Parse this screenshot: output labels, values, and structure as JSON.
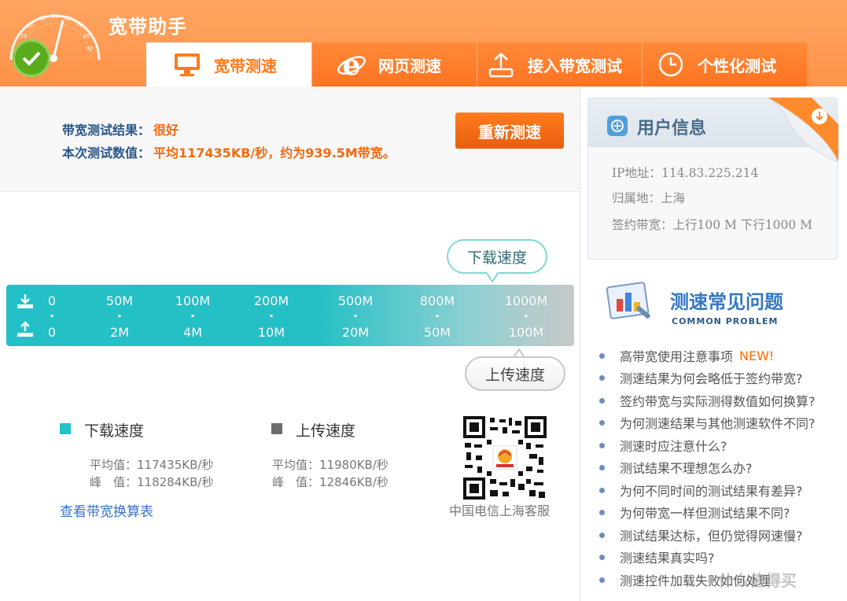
{
  "app": {
    "title": "宽带助手"
  },
  "gauge_ticks": [
    "10",
    "20",
    "30",
    "40",
    "50",
    "60",
    "70",
    "80",
    "90"
  ],
  "tabs": [
    {
      "label": "宽带测速",
      "icon": "monitor-icon",
      "active": true
    },
    {
      "label": "网页测速",
      "icon": "ie-browser-icon",
      "active": false
    },
    {
      "label": "接入带宽测试",
      "icon": "upload-tray-icon",
      "active": false
    },
    {
      "label": "个性化测试",
      "icon": "clock-icon",
      "active": false
    }
  ],
  "result": {
    "label1": "带宽测试结果：",
    "value1": "很好",
    "label2": "本次测试数值：",
    "value2": "平均117435KB/秒，约为939.5M带宽。",
    "retest_label": "重新测速"
  },
  "speed_bar": {
    "download_bubble": "下载速度",
    "upload_bubble": "上传速度",
    "download_ticks": [
      "0",
      "50M",
      "100M",
      "200M",
      "500M",
      "800M",
      "1000M"
    ],
    "upload_ticks": [
      "0",
      "2M",
      "4M",
      "10M",
      "20M",
      "50M",
      "100M"
    ]
  },
  "stats": {
    "download": {
      "title": "下载速度",
      "avg": "平均值：117435KB/秒",
      "peak": "峰　值：118284KB/秒",
      "color": "#1fc3c9"
    },
    "upload": {
      "title": "上传速度",
      "avg": "平均值：11980KB/秒",
      "peak": "峰　值：12846KB/秒",
      "color": "#6d6d6d"
    },
    "link": "查看带宽换算表",
    "qr_label": "中国电信上海客服"
  },
  "user_info": {
    "title": "用户信息",
    "ip": "IP地址：114.83.225.214",
    "location": "归属地：上海",
    "bandwidth": "签约带宽：上行100 M 下行1000 M"
  },
  "faq": {
    "title": "测速常见问题",
    "subtitle": "COMMON PROBLEM",
    "new_badge": "NEW!",
    "items": [
      "高带宽使用注意事项",
      "测速结果为何会略低于签约带宽?",
      "签约带宽与实际测得数值如何换算?",
      "为何测速结果与其他测速软件不同?",
      "测速时应注意什么?",
      "测试结果不理想怎么办?",
      "为何不同时间的测试结果有差异?",
      "为何带宽一样但测试结果不同?",
      "测试结果达标，但仍觉得网速慢?",
      "测速结果真实吗?",
      "测速控件加载失败如何处理"
    ]
  },
  "watermark": "什么值得买",
  "colors": {
    "header": "#ff9a50",
    "accent": "#f06a10",
    "teal": "#23c1c7",
    "link": "#3a72c4"
  }
}
